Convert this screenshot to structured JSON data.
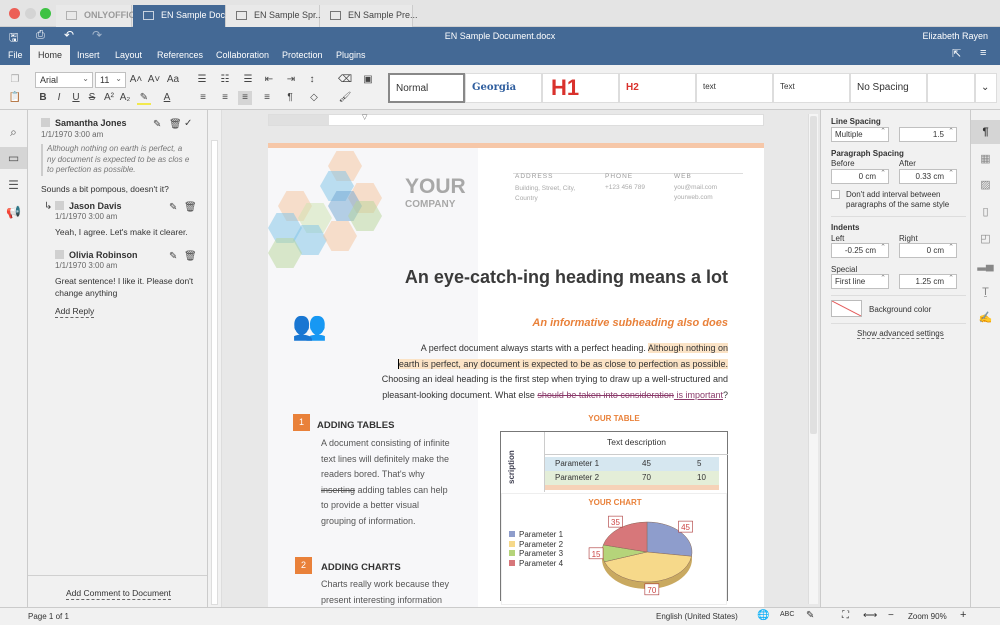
{
  "window_tabs": [
    {
      "label": "ONLYOFFICE",
      "active": false
    },
    {
      "label": "EN Sample Doc...",
      "active": true
    },
    {
      "label": "EN Sample Spr...",
      "active": false
    },
    {
      "label": "EN Sample Pre...",
      "active": false
    }
  ],
  "titlebar": {
    "title": "EN Sample Document.docx",
    "user": "Elizabeth Rayen"
  },
  "menu": [
    "File",
    "Home",
    "Insert",
    "Layout",
    "References",
    "Collaboration",
    "Protection",
    "Plugins"
  ],
  "toolbar": {
    "font": "Arial",
    "size": "11"
  },
  "styles": [
    "Normal",
    "Georgia",
    "H1",
    "H2",
    "text",
    "Text",
    "No Spacing"
  ],
  "comments": {
    "main": {
      "author": "Samantha Jones",
      "date": "1/1/1970 3:00 am",
      "quote": "Although nothing on earth is perfect, a ny document is expected to be as clos e to perfection as possible.",
      "text": "Sounds a bit pompous, doesn't it?"
    },
    "replies": [
      {
        "author": "Jason Davis",
        "date": "1/1/1970 3:00 am",
        "text": "Yeah, I agree. Let's make it clearer."
      },
      {
        "author": "Olivia Robinson",
        "date": "1/1/1970 3:00 am",
        "text": "Great sentence! I like it. Please don't change anything"
      }
    ],
    "add_reply": "Add Reply",
    "add_comment": "Add Comment to Document"
  },
  "document": {
    "company_1": "YOUR",
    "company_2": "COMPANY",
    "address_label": "ADDRESS",
    "address": "Building, Street, City, Country",
    "phone_label": "PHONE",
    "phone": "+123 456 789",
    "web_label": "WEB",
    "web_1": "you@mail.com",
    "web_2": "yourweb.com",
    "heading": "An eye-catch-ing heading means a lot",
    "subheading": "An informative subheading also does",
    "p1_a": "A perfect document always starts with a perfect heading. ",
    "p1_hl1": "Although nothing on",
    "p1_hl2": "earth is perfect, any document is expected to be as close to perfection as possible.",
    "p1_c": "Choosing an ideal heading is the first step when trying to draw up a well-structured and",
    "p1_d": "pleasant-looking document. What else ",
    "p1_del": "should be taken into consideration",
    "p1_ins": " is important",
    "p1_end": "?",
    "s1_num": "1",
    "s1_title": "ADDING TABLES",
    "s1_l1": "A document consisting of infinite",
    "s1_l2": "text lines will definitely make the",
    "s1_l3": "readers bored. That's why",
    "s1_del": "inserting",
    "s1_l4": " adding tables can help",
    "s1_l5": "to provide a better visual",
    "s1_l6": "grouping of information.",
    "s2_num": "2",
    "s2_title": "ADDING CHARTS",
    "s2_l1": "Charts really work because they",
    "s2_l2": "present interesting information",
    "table_title": "YOUR TABLE",
    "table_header": "Text description",
    "table_side": "scription",
    "table_rows": [
      [
        "Parameter 1",
        "45",
        "5"
      ],
      [
        "Parameter 2",
        "70",
        "10"
      ]
    ]
  },
  "chart_data": {
    "type": "pie",
    "title": "YOUR CHART",
    "categories": [
      "Parameter 1",
      "Parameter 2",
      "Parameter 3",
      "Parameter 4"
    ],
    "values": [
      45,
      70,
      15,
      35
    ],
    "colors": [
      "#8e9dcc",
      "#f6d98a",
      "#b5d47a",
      "#d7777a"
    ],
    "legend": "left"
  },
  "paragraph_settings": {
    "line_spacing_label": "Line Spacing",
    "line_spacing_mode": "Multiple",
    "line_spacing_value": "1.5",
    "para_spacing_label": "Paragraph Spacing",
    "before_label": "Before",
    "before": "0 cm",
    "after_label": "After",
    "after": "0.33 cm",
    "no_interval": "Don't add interval between paragraphs of the same style",
    "indents_label": "Indents",
    "left_label": "Left",
    "left": "-0.25 cm",
    "right_label": "Right",
    "right": "0 cm",
    "special_label": "Special",
    "special": "First line",
    "special_value": "1.25 cm",
    "bg_color": "Background color",
    "advanced": "Show advanced settings"
  },
  "status": {
    "page": "Page 1 of 1",
    "language": "English (United States)",
    "zoom": "Zoom 90%"
  },
  "colors": {
    "brand": "#446995",
    "accent": "#e9813a"
  }
}
